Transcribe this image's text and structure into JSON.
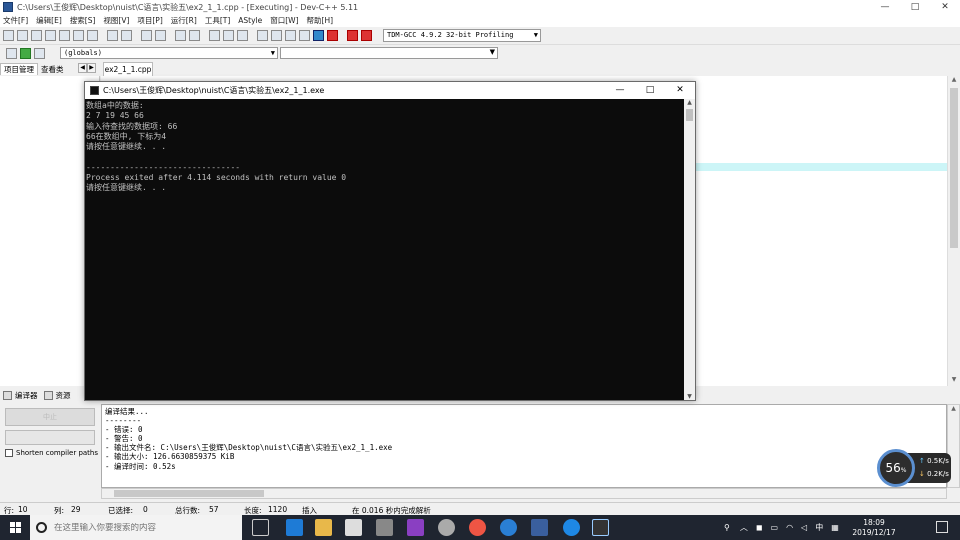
{
  "ide": {
    "title": "C:\\Users\\王俊辉\\Desktop\\nuist\\C语言\\实验五\\ex2_1_1.cpp - [Executing] - Dev-C++ 5.11",
    "window_controls": {
      "minimize": "—",
      "maximize": "□",
      "close": "✕"
    },
    "menu": [
      "文件[F]",
      "编辑[E]",
      "搜索[S]",
      "视图[V]",
      "项目[P]",
      "运行[R]",
      "工具[T]",
      "AStyle",
      "窗口[W]",
      "帮助[H]"
    ],
    "compiler_select": "TDM-GCC 4.9.2 32-bit Profiling",
    "scope_select": "(globals)",
    "left_tabs": [
      "项目管理",
      "查看类"
    ],
    "file_tab": "ex2_1_1.cpp",
    "bottom_tabs": [
      "编译器",
      "资源"
    ],
    "abort_label": "中止",
    "shorten_label": "Shorten compiler paths",
    "compile_log": [
      "编译结果...",
      "--------",
      "- 错误: 0",
      "- 警告: 0",
      "- 输出文件名: C:\\Users\\王俊辉\\Desktop\\nuist\\C语言\\实验五\\ex2_1_1.exe",
      "- 输出大小: 126.6630859375 KiB",
      "- 编译时间: 0.52s"
    ],
    "status": {
      "line_label": "行:",
      "line_value": "10",
      "col_label": "列:",
      "col_value": "29",
      "sel_label": "已选择:",
      "sel_value": "0",
      "total_label": "总行数:",
      "total_value": "57",
      "len_label": "长度:",
      "len_value": "1120",
      "mode": "插入",
      "parse": "在 0.016 秒内完成解析"
    }
  },
  "console": {
    "title": "C:\\Users\\王俊辉\\Desktop\\nuist\\C语言\\实验五\\ex2_1_1.exe",
    "window_controls": {
      "minimize": "—",
      "maximize": "□",
      "close": "✕"
    },
    "lines": [
      "数组a中的数据:",
      "2 7 19 45 66",
      "输入待查找的数据项: 66",
      "66在数组中, 下标为4",
      "请按任意键继续. . .",
      "",
      "--------------------------------",
      "Process exited after 4.114 seconds with return value 0",
      "请按任意键继续. . ."
    ]
  },
  "netwidget": {
    "percent": "56",
    "percent_unit": "%",
    "up_rate": "0.5",
    "up_unit": "K/s",
    "down_rate": "0.2",
    "down_unit": "K/s"
  },
  "taskbar": {
    "search_placeholder": "在这里输入你要搜索的内容",
    "ime": "中",
    "time": "18:09",
    "date": "2019/12/17"
  }
}
